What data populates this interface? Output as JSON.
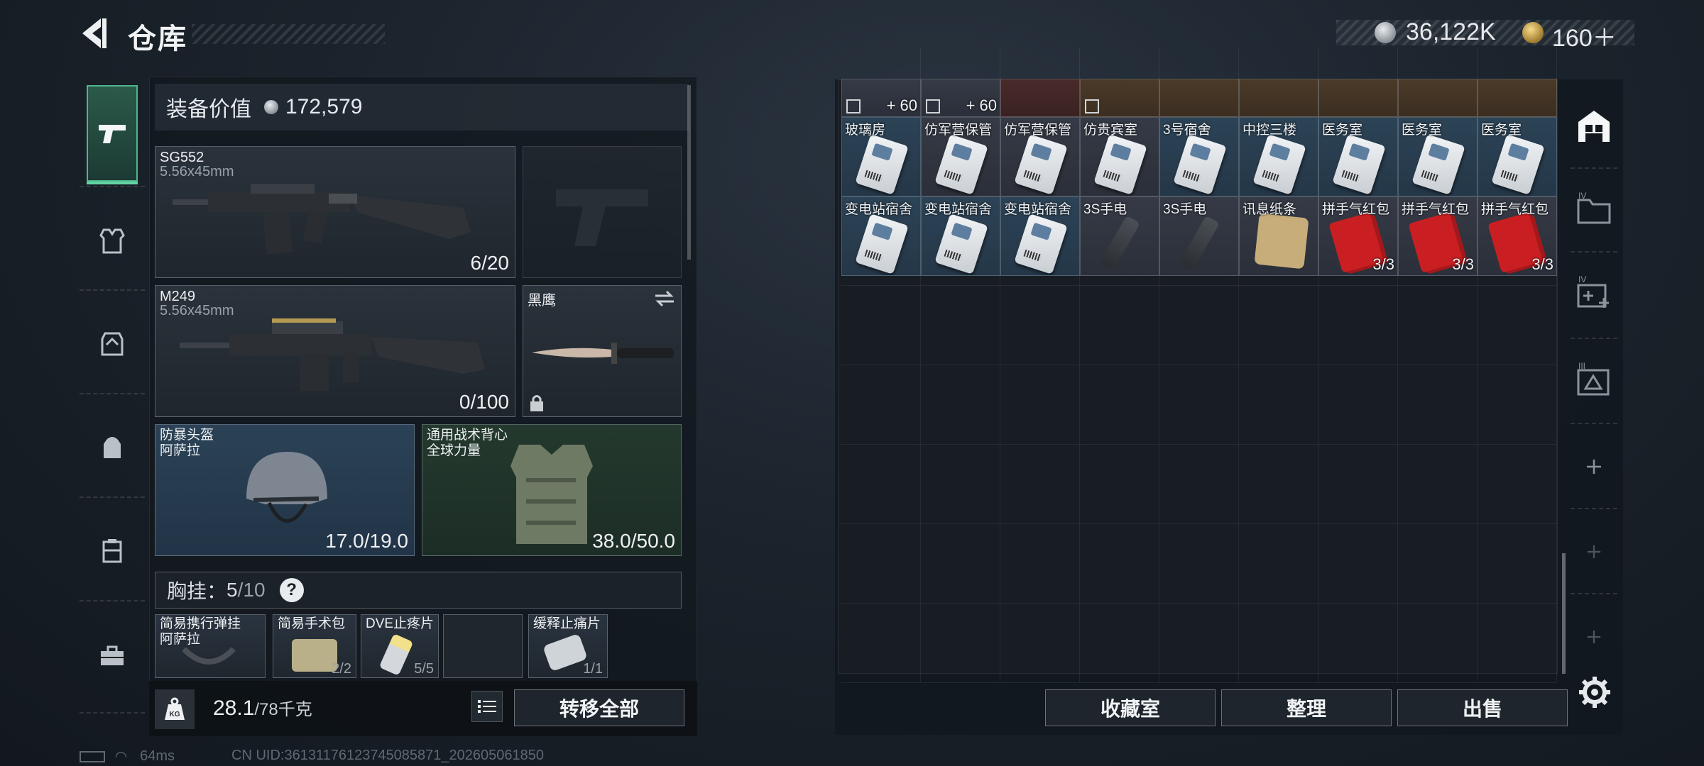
{
  "header": {
    "title": "仓库",
    "silver_amount": "36,122K",
    "gold_amount": "160＋"
  },
  "left_nav": {
    "items": [
      "weapon-tab",
      "armor-tab",
      "rig-tab",
      "backpack-tab",
      "container-tab",
      "toolbox-tab"
    ]
  },
  "equipment": {
    "value_label": "装备价值",
    "value_amount": "172,579",
    "primary": {
      "name": "SG552",
      "caliber": "5.56x45mm",
      "ammo": "6/20"
    },
    "secondary": {
      "name": "M249",
      "caliber": "5.56x45mm",
      "ammo": "0/100"
    },
    "melee": {
      "name": "黑鹰"
    },
    "helmet": {
      "name": "防暴头盔\n阿萨拉",
      "durability": "17.0/19.0"
    },
    "vest": {
      "name": "通用战术背心\n全球力量",
      "durability": "38.0/50.0"
    },
    "chest_label": "胸挂：",
    "chest_used": "5",
    "chest_total": "/10",
    "chest_help": "?",
    "chest_items": [
      {
        "name": "简易携行弹挂\n阿萨拉",
        "count": ""
      },
      {
        "name": "简易手术包",
        "count": "2/2"
      },
      {
        "name": "DVE止疼片",
        "count": "5/5"
      },
      {
        "name": "",
        "count": ""
      },
      {
        "name": "缓释止痛片",
        "count": "1/1"
      }
    ],
    "weight_current": "28.1",
    "weight_max": "/78千克",
    "transfer_all": "转移全部"
  },
  "storage": {
    "top_row": [
      {
        "name": "",
        "count": "+ 60",
        "bg": "gray"
      },
      {
        "name": "",
        "count": "+ 60",
        "bg": "gray"
      },
      {
        "name": "",
        "count": "",
        "bg": "red"
      },
      {
        "name": "",
        "count": "",
        "bg": "orange"
      },
      {
        "name": "",
        "count": "",
        "bg": "orange"
      },
      {
        "name": "",
        "count": "",
        "bg": "orange"
      },
      {
        "name": "",
        "count": "",
        "bg": "orange"
      },
      {
        "name": "",
        "count": "",
        "bg": "orange"
      },
      {
        "name": "",
        "count": "",
        "bg": "orange"
      }
    ],
    "row1": [
      {
        "name": "玻璃房",
        "count": ""
      },
      {
        "name": "仿军营保管",
        "count": ""
      },
      {
        "name": "仿军营保管",
        "count": ""
      },
      {
        "name": "仿贵宾室",
        "count": ""
      },
      {
        "name": "3号宿舍",
        "count": ""
      },
      {
        "name": "中控三楼",
        "count": ""
      },
      {
        "name": "医务室",
        "count": ""
      },
      {
        "name": "医务室",
        "count": ""
      },
      {
        "name": "医务室",
        "count": ""
      }
    ],
    "row2": [
      {
        "name": "变电站宿舍",
        "count": ""
      },
      {
        "name": "变电站宿舍",
        "count": ""
      },
      {
        "name": "变电站宿舍",
        "count": ""
      },
      {
        "name": "3S手电",
        "count": ""
      },
      {
        "name": "3S手电",
        "count": ""
      },
      {
        "name": "讯息纸条",
        "count": ""
      },
      {
        "name": "拼手气红包",
        "count": "3/3"
      },
      {
        "name": "拼手气红包",
        "count": "3/3"
      },
      {
        "name": "拼手气红包",
        "count": "3/3"
      }
    ],
    "buttons": {
      "collection": "收藏室",
      "sort": "整理",
      "sell": "出售"
    }
  },
  "status": {
    "ping": "64ms",
    "uid": "CN UID:36131176123745085871_202605061850"
  }
}
